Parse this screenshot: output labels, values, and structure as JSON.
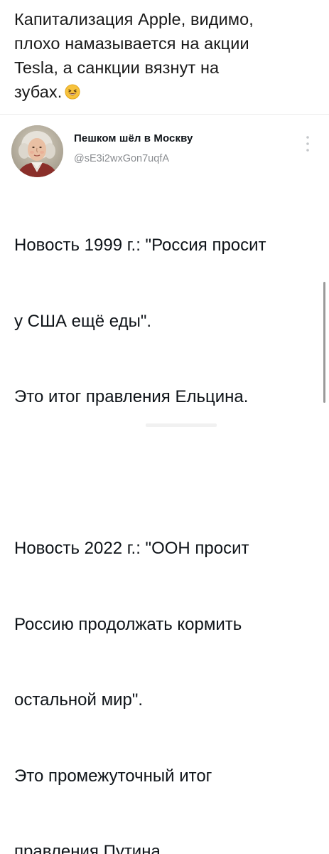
{
  "caption": {
    "lines": [
      "Капитализация Apple, видимо,",
      "плохо намазывается на акции",
      "Tesla, а санкции вязнут на",
      "зубах."
    ],
    "emoji_icon": "grinning-squinting-face-icon"
  },
  "tweet": {
    "author": {
      "name": "Пешком шёл в Москву",
      "handle": "@sE3i2wxGon7uqfA",
      "avatar_icon": "portrait-avatar"
    },
    "more_icon": "vertical-dots-icon",
    "paragraphs": [
      {
        "lines": [
          "Новость 1999 г.: \"Россия просит",
          "у США ещё еды\".",
          "Это итог правления Ельцина."
        ]
      },
      {
        "lines": [
          "Новость 2022 г.: \"ООН просит",
          "Россию продолжать кормить",
          "остальной мир\".",
          "Это промежуточный итог",
          "правления Путина."
        ]
      }
    ]
  },
  "colors": {
    "text": "#0f1419",
    "handle": "#8a8d91",
    "emoji": "#f7c23c"
  }
}
